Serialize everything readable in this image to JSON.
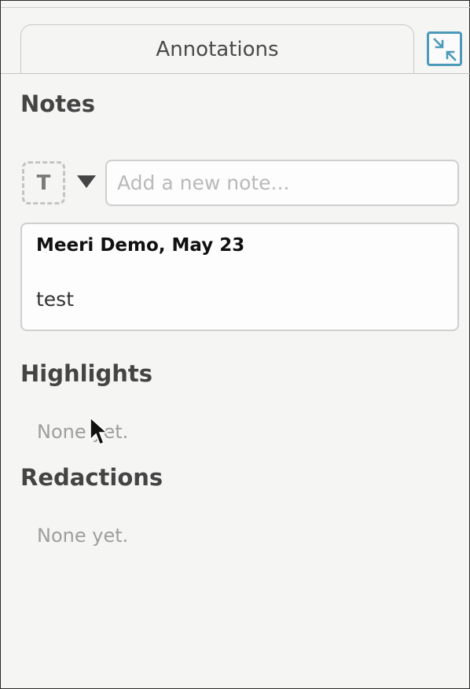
{
  "panel": {
    "tab_label": "Annotations",
    "collapse_icon": "collapse-arrows-icon"
  },
  "notes": {
    "title": "Notes",
    "type_icon_letter": "T",
    "input_placeholder": "Add a new note...",
    "items": [
      {
        "author_date": "Meeri Demo, May 23",
        "body": "test"
      }
    ]
  },
  "highlights": {
    "title": "Highlights",
    "empty_text": "None yet."
  },
  "redactions": {
    "title": "Redactions",
    "empty_text": "None yet."
  },
  "colors": {
    "accent": "#4c9ab9",
    "background": "#f5f5f4"
  }
}
